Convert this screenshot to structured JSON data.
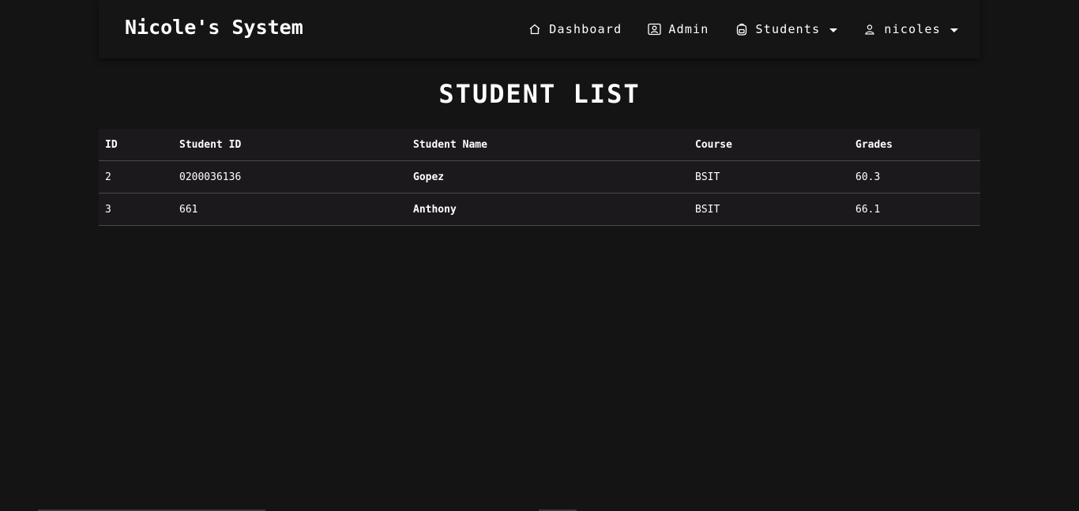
{
  "brand": "Nicole's System",
  "nav": {
    "dashboard": {
      "label": "Dashboard",
      "icon": "home-icon"
    },
    "admin": {
      "label": "Admin",
      "icon": "admin-badge-icon"
    },
    "students": {
      "label": "Students",
      "icon": "backpack-icon"
    },
    "user": {
      "label": "nicoles",
      "icon": "user-icon"
    }
  },
  "page": {
    "title": "STUDENT LIST"
  },
  "table": {
    "headers": [
      "ID",
      "Student ID",
      "Student Name",
      "Course",
      "Grades"
    ],
    "rows": [
      [
        "2",
        "0200036136",
        "Gopez",
        "BSIT",
        "60.3"
      ],
      [
        "3",
        "661",
        "Anthony",
        "BSIT",
        "66.1"
      ]
    ]
  }
}
